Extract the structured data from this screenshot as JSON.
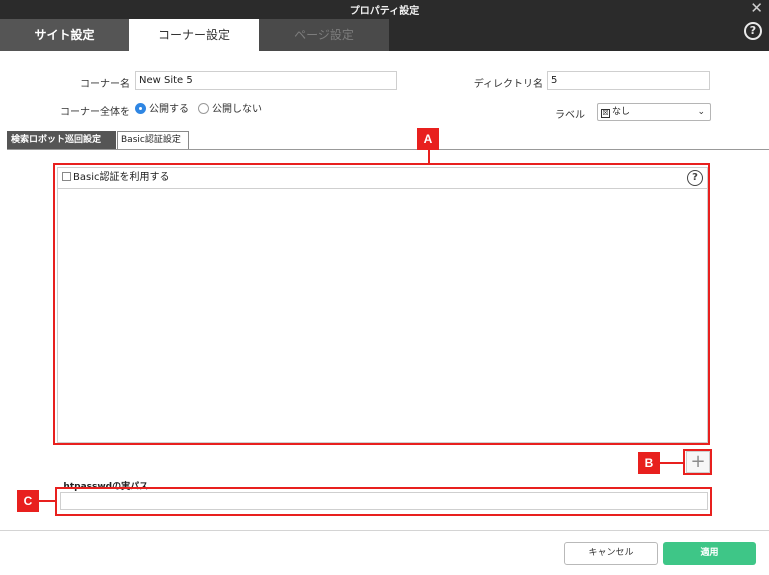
{
  "window": {
    "title": "プロパティ設定",
    "close_glyph": "✕",
    "help_glyph": "?"
  },
  "tabs": [
    {
      "label": "サイト設定",
      "state": "inactive"
    },
    {
      "label": "コーナー設定",
      "state": "active"
    },
    {
      "label": "ページ設定",
      "state": "disabled"
    }
  ],
  "form": {
    "corner_name_label": "コーナー名",
    "corner_name_value": "New Site 5",
    "directory_label": "ディレクトリ名",
    "directory_value": "5",
    "publish_label": "コーナー全体を",
    "publish_on": "公開する",
    "publish_off": "公開しない",
    "publish_selected": "公開する",
    "label_label": "ラベル",
    "label_value": "なし",
    "label_icon": "☒",
    "chevron": "⌄"
  },
  "subtabs": [
    {
      "label": "検索ロボット巡回設定",
      "state": "inactive"
    },
    {
      "label": "Basic認証設定",
      "state": "active"
    }
  ],
  "basic_auth": {
    "use_checkbox_label": "Basic認証を利用する",
    "use_checked": false,
    "help_glyph": "?",
    "add_glyph": "+",
    "htpasswd_label": ".htpasswdの実パス",
    "htpasswd_value": ""
  },
  "annotations": {
    "a": "A",
    "b": "B",
    "c": "C",
    "color": "#e8201e"
  },
  "footer": {
    "cancel_label": "キャンセル",
    "apply_label": "適用",
    "apply_color": "#3ec687"
  }
}
